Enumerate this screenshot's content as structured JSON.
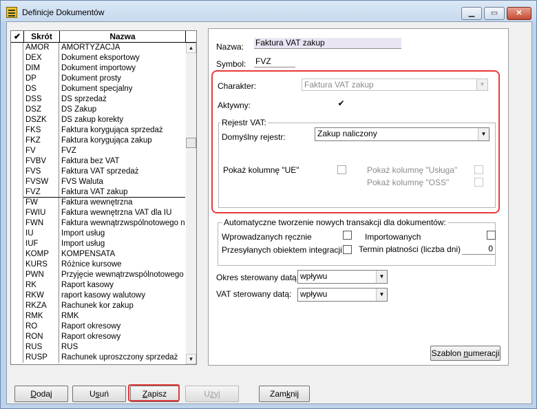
{
  "window": {
    "title": "Definicje Dokumentów",
    "controls": [
      "minimize-icon",
      "maximize-icon",
      "close-icon"
    ]
  },
  "list": {
    "headers": {
      "check": "✔",
      "code": "Skrót",
      "name": "Nazwa"
    },
    "rows": [
      {
        "code": "AMOR",
        "name": "AMORTYZACJA"
      },
      {
        "code": "DEX",
        "name": "Dokument eksportowy"
      },
      {
        "code": "DIM",
        "name": "Dokument importowy"
      },
      {
        "code": "DP",
        "name": "Dokument prosty"
      },
      {
        "code": "DS",
        "name": "Dokument specjalny"
      },
      {
        "code": "DSS",
        "name": "DS sprzedaż"
      },
      {
        "code": "DSZ",
        "name": "DS Zakup"
      },
      {
        "code": "DSZK",
        "name": "DS zakup korekty"
      },
      {
        "code": "FKS",
        "name": "Faktura korygująca sprzedaż"
      },
      {
        "code": "FKZ",
        "name": "Faktura korygująca zakup"
      },
      {
        "code": "FV",
        "name": "FVZ"
      },
      {
        "code": "FVBV",
        "name": "Faktura bez VAT"
      },
      {
        "code": "FVS",
        "name": "Faktura VAT sprzedaż"
      },
      {
        "code": "FVSW",
        "name": "FVS Waluta"
      },
      {
        "code": "FVZ",
        "name": "Faktura VAT zakup",
        "selected": true
      },
      {
        "code": "FW",
        "name": "Faktura wewnętrzna"
      },
      {
        "code": "FWIU",
        "name": "Faktura wewnętrzna VAT dla IU"
      },
      {
        "code": "FWN",
        "name": "Faktura wewnątrzwspólnotowego na"
      },
      {
        "code": "IU",
        "name": "Import usług"
      },
      {
        "code": "IUF",
        "name": "Import usług"
      },
      {
        "code": "KOMP",
        "name": "KOMPENSATA"
      },
      {
        "code": "KURS",
        "name": "Różnice kursowe"
      },
      {
        "code": "PWN",
        "name": "Przyjęcie wewnątrzwspólnotowego n"
      },
      {
        "code": "RK",
        "name": "Raport kasowy"
      },
      {
        "code": "RKW",
        "name": "raport kasowy walutowy"
      },
      {
        "code": "RKZA",
        "name": "Rachunek kor zakup"
      },
      {
        "code": "RMK",
        "name": "RMK"
      },
      {
        "code": "RO",
        "name": "Raport okresowy"
      },
      {
        "code": "RON",
        "name": "Raport okresowy"
      },
      {
        "code": "RUS",
        "name": "RUS"
      },
      {
        "code": "RUSP",
        "name": "Rachunek uproszczony sprzedaż"
      }
    ]
  },
  "form": {
    "nazwa_label": "Nazwa:",
    "nazwa_value": "Faktura VAT zakup",
    "symbol_label": "Symbol:",
    "symbol_value": "FVZ",
    "charakter_label": "Charakter:",
    "charakter_value": "Faktura VAT zakup",
    "aktywny_label": "Aktywny:",
    "aktywny_checked": true,
    "rejestr_group_title": "Rejestr VAT:",
    "domyslny_label": "Domyślny rejestr:",
    "domyslny_value": "Zakup naliczony",
    "pokaz_ue_label": "Pokaż kolumnę \"UE\"",
    "pokaz_usluga_label": "Pokaż kolumnę \"Usługa\"",
    "pokaz_oss_label": "Pokaż kolumnę \"OSS\"",
    "auto_group_title": "Automatyczne tworzenie nowych transakcji dla dokumentów:",
    "wprowadzanych_label": "Wprowadzanych ręcznie",
    "importowanych_label": "Importowanych",
    "przesylanych_label": "Przesyłanych obiektem integracji",
    "termin_label": "Termin płatności (liczba dni)",
    "termin_value": "0",
    "okres_label": "Okres sterowany datą:",
    "okres_value": "wpływu",
    "vat_label": "VAT sterowany datą:",
    "vat_value": "wpływu",
    "szablon_pre": "Szablon ",
    "szablon_u": "n",
    "szablon_post": "umeracji"
  },
  "buttons": {
    "dodaj_u": "D",
    "dodaj_rest": "odaj",
    "usun_pre": "U",
    "usun_u": "s",
    "usun_post": "uń",
    "zapisz_u": "Z",
    "zapisz_rest": "apisz",
    "uzyj_pre": "U",
    "uzyj_u": "ż",
    "uzyj_post": "yj",
    "zamknij_pre": "Zam",
    "zamknij_u": "k",
    "zamknij_post": "nij"
  }
}
